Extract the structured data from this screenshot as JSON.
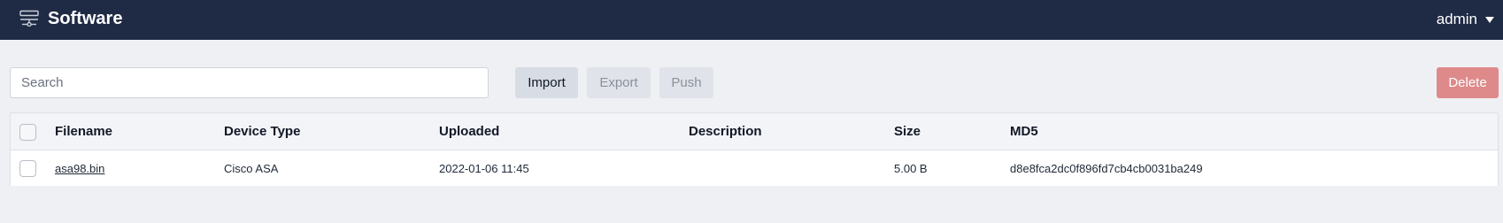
{
  "header": {
    "title": "Software",
    "app_icon": "server-settings-icon",
    "user": "admin",
    "user_caret_icon": "caret-down-icon"
  },
  "toolbar": {
    "search_placeholder": "Search",
    "search_value": "",
    "import_label": "Import",
    "export_label": "Export",
    "push_label": "Push",
    "delete_label": "Delete"
  },
  "table": {
    "columns": [
      "Filename",
      "Device Type",
      "Uploaded",
      "Description",
      "Size",
      "MD5"
    ],
    "rows": [
      {
        "filename": "asa98.bin",
        "device_type": "Cisco ASA",
        "uploaded": "2022-01-06 11:45",
        "description": "",
        "size": "5.00 B",
        "md5": "d8e8fca2dc0f896fd7cb4cb0031ba249"
      }
    ]
  },
  "colors": {
    "header_bg": "#1f2a44",
    "page_bg": "#eff0f4",
    "delete_bg": "#de8a8a"
  }
}
